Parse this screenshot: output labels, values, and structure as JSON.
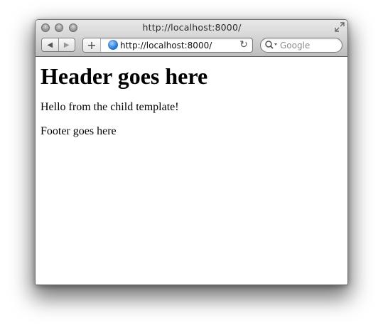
{
  "window": {
    "title": "http://localhost:8000/"
  },
  "toolbar": {
    "back_glyph": "◀",
    "forward_glyph": "▶",
    "add_glyph": "+",
    "reload_glyph": "↻",
    "url_value": "http://localhost:8000/",
    "search_placeholder": "Google"
  },
  "page": {
    "header": "Header goes here",
    "child_text": "Hello from the child template!",
    "footer": "Footer goes here"
  },
  "icons": {
    "close": "close-icon",
    "minimize": "minimize-icon",
    "zoom": "zoom-icon",
    "fullscreen": "fullscreen-icon",
    "globe": "globe-icon",
    "reload": "reload-icon",
    "search": "search-icon"
  }
}
